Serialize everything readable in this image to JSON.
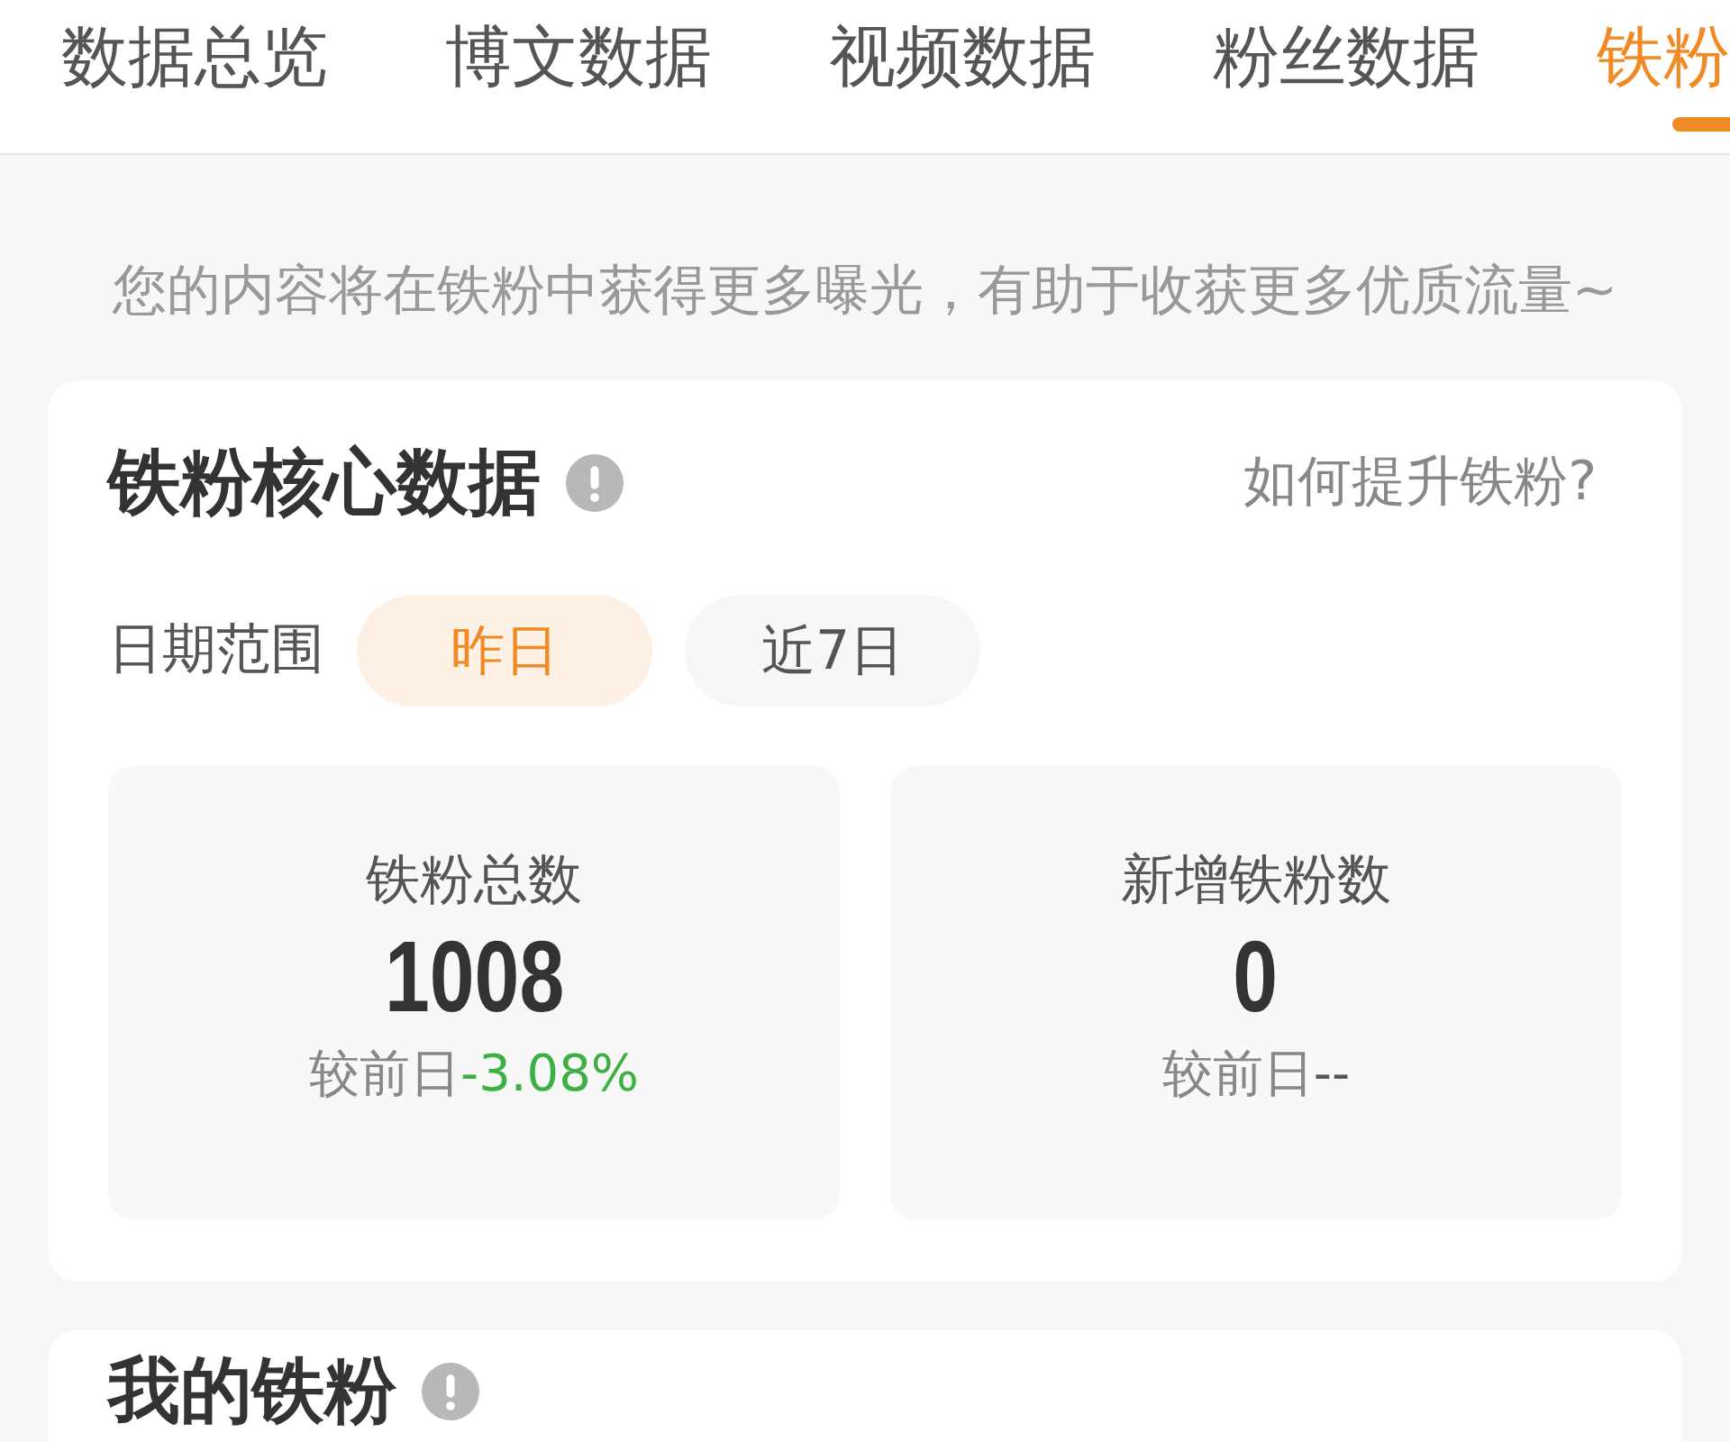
{
  "tabs": [
    {
      "label": "数据总览",
      "selected": false
    },
    {
      "label": "博文数据",
      "selected": false
    },
    {
      "label": "视频数据",
      "selected": false
    },
    {
      "label": "粉丝数据",
      "selected": false
    },
    {
      "label": "铁粉",
      "selected": true
    }
  ],
  "notice": "您的内容将在铁粉中获得更多曝光，有助于收获更多优质流量~",
  "core_card": {
    "title": "铁粉核心数据",
    "help_link": "如何提升铁粉?",
    "date_range": {
      "label": "日期范围",
      "options": [
        {
          "label": "昨日",
          "selected": true
        },
        {
          "label": "近7日",
          "selected": false
        }
      ]
    },
    "stats": [
      {
        "label": "铁粉总数",
        "value": "1008",
        "compare_label": "较前日",
        "change": "-3.08%",
        "color": "#3cb043"
      },
      {
        "label": "新增铁粉数",
        "value": "0",
        "compare_label": "较前日",
        "change": "--",
        "color": "#555555"
      }
    ]
  },
  "fans_card": {
    "title": "我的铁粉"
  }
}
